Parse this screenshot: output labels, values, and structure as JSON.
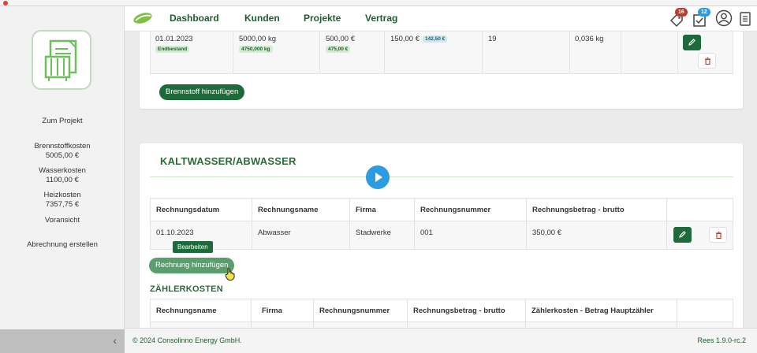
{
  "sidebar": {
    "project_link": "Zum Projekt",
    "fuel_costs_label": "Brennstoffkosten",
    "fuel_costs_value": "5005,00 €",
    "water_costs_label": "Wasserkosten",
    "water_costs_value": "1100,00 €",
    "heating_costs_label": "Heizkosten",
    "heating_costs_value": "7357,75 €",
    "preview_link": "Voransicht",
    "create_bill_link": "Abrechnung erstellen",
    "collapse_icon": "chevron-left-icon"
  },
  "nav": {
    "items": [
      "Dashboard",
      "Kunden",
      "Projekte",
      "Vertrag"
    ],
    "notif_badge": "16",
    "notif_badge_color": "#c0392b",
    "tasks_badge": "12",
    "tasks_badge_color": "#2b9be2"
  },
  "fuel_row": {
    "date": "01.01.2023",
    "date_tag": "Endbestand",
    "amount": "5000,00 kg",
    "amount_tag": "4750,000 kg",
    "price": "500,00 €",
    "price_tag": "475,00 €",
    "cost": "150,00 €",
    "cost_tag": "142,50 €",
    "count": "19",
    "consumption": "0,036 kg",
    "add_button": "Brennstoff hinzufügen"
  },
  "water": {
    "title": "KALTWASSER/ABWASSER",
    "headers": [
      "Rechnungsdatum",
      "Rechnungsname",
      "Firma",
      "Rechnungsnummer",
      "Rechnungsbetrag - brutto"
    ],
    "rows": [
      [
        "01.10.2023",
        "Abwasser",
        "Stadwerke",
        "001",
        "350,00 €"
      ]
    ],
    "tooltip": "Bearbeiten",
    "add_button": "Rechnung hinzufügen"
  },
  "meter": {
    "title": "ZÄHLERKOSTEN",
    "headers": [
      "Rechnungsname",
      "Firma",
      "Rechnungsnummer",
      "Rechnungsbetrag - brutto",
      "Zählerkosten - Betrag Hauptzähler"
    ]
  },
  "footer": {
    "copyright": "© 2024 Consolinno Energy GmbH.",
    "version": "Rees 1.9.0-rc.2"
  },
  "colors": {
    "brand_green": "#1d6b3a",
    "title_green": "#2e6a38",
    "play_blue": "#2b9be2"
  }
}
